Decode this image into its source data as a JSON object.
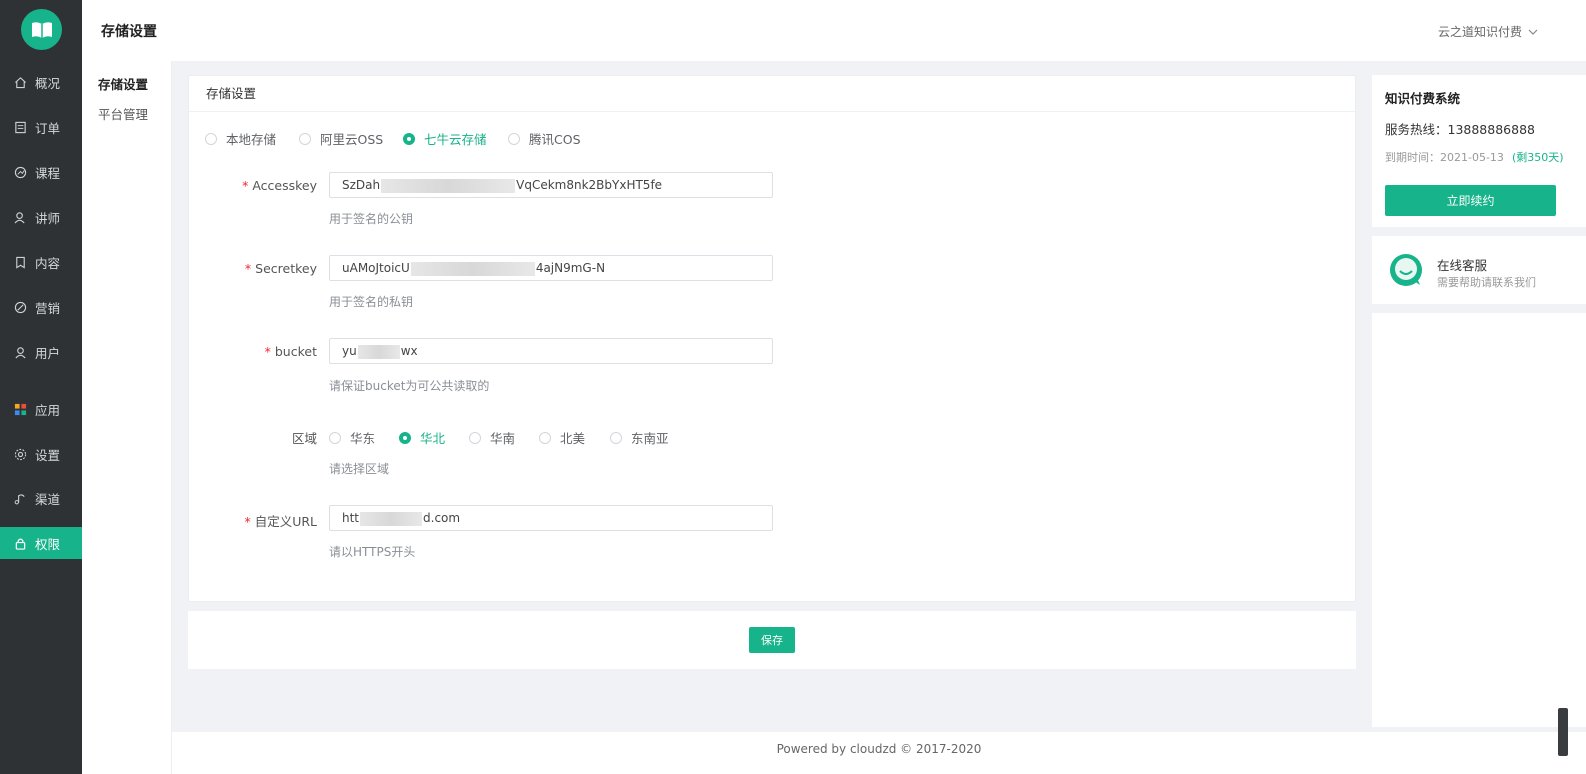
{
  "sidebar": {
    "items": [
      {
        "label": "概况",
        "icon": "home-icon"
      },
      {
        "label": "订单",
        "icon": "order-icon"
      },
      {
        "label": "课程",
        "icon": "course-icon"
      },
      {
        "label": "讲师",
        "icon": "lecturer-icon"
      },
      {
        "label": "内容",
        "icon": "content-icon"
      },
      {
        "label": "营销",
        "icon": "marketing-icon"
      },
      {
        "label": "用户",
        "icon": "user-icon"
      },
      {
        "label": "应用",
        "icon": "apps-icon"
      },
      {
        "label": "设置",
        "icon": "gear-icon"
      },
      {
        "label": "渠道",
        "icon": "channel-icon"
      },
      {
        "label": "权限",
        "icon": "lock-icon"
      }
    ],
    "active_index": 10,
    "accent": "#17b38a",
    "bg": "#2f3235"
  },
  "header": {
    "title": "存储设置",
    "account": "云之道知识付费"
  },
  "subnav": {
    "items": [
      "存储设置",
      "平台管理"
    ]
  },
  "form": {
    "card_title": "存储设置",
    "storage_options": [
      "本地存储",
      "阿里云OSS",
      "七牛云存储",
      "腾讯COS"
    ],
    "storage_selected": "七牛云存储",
    "fields": {
      "accesskey": {
        "label": "Accesskey",
        "prefix": "SzDah",
        "suffix": "VqCekm8nk2BbYxHT5fe",
        "help": "用于签名的公钥"
      },
      "secretkey": {
        "label": "Secretkey",
        "prefix": "uAMoJtoicU",
        "suffix": "4ajN9mG-N",
        "help": "用于签名的私钥"
      },
      "bucket": {
        "label": "bucket",
        "prefix": "yu",
        "suffix": "wx",
        "help": "请保证bucket为可公共读取的"
      },
      "region": {
        "label": "区域",
        "options": [
          "华东",
          "华北",
          "华南",
          "北美",
          "东南亚"
        ],
        "selected": "华北",
        "help": "请选择区域"
      },
      "custom_url": {
        "label": "自定义URL",
        "prefix": "htt",
        "suffix": "d.com",
        "help": "请以HTTPS开头"
      }
    },
    "save_label": "保存"
  },
  "right_panel": {
    "system_name": "知识付费系统",
    "hotline": "服务热线：13888886888",
    "expire_label": "到期时间：2021-05-13",
    "days_left": "(剩350天)",
    "renew_label": "立即续约",
    "cs_title": "在线客服",
    "cs_desc": "需要帮助请联系我们"
  },
  "footer": {
    "text": "Powered by cloudzd © 2017-2020"
  }
}
